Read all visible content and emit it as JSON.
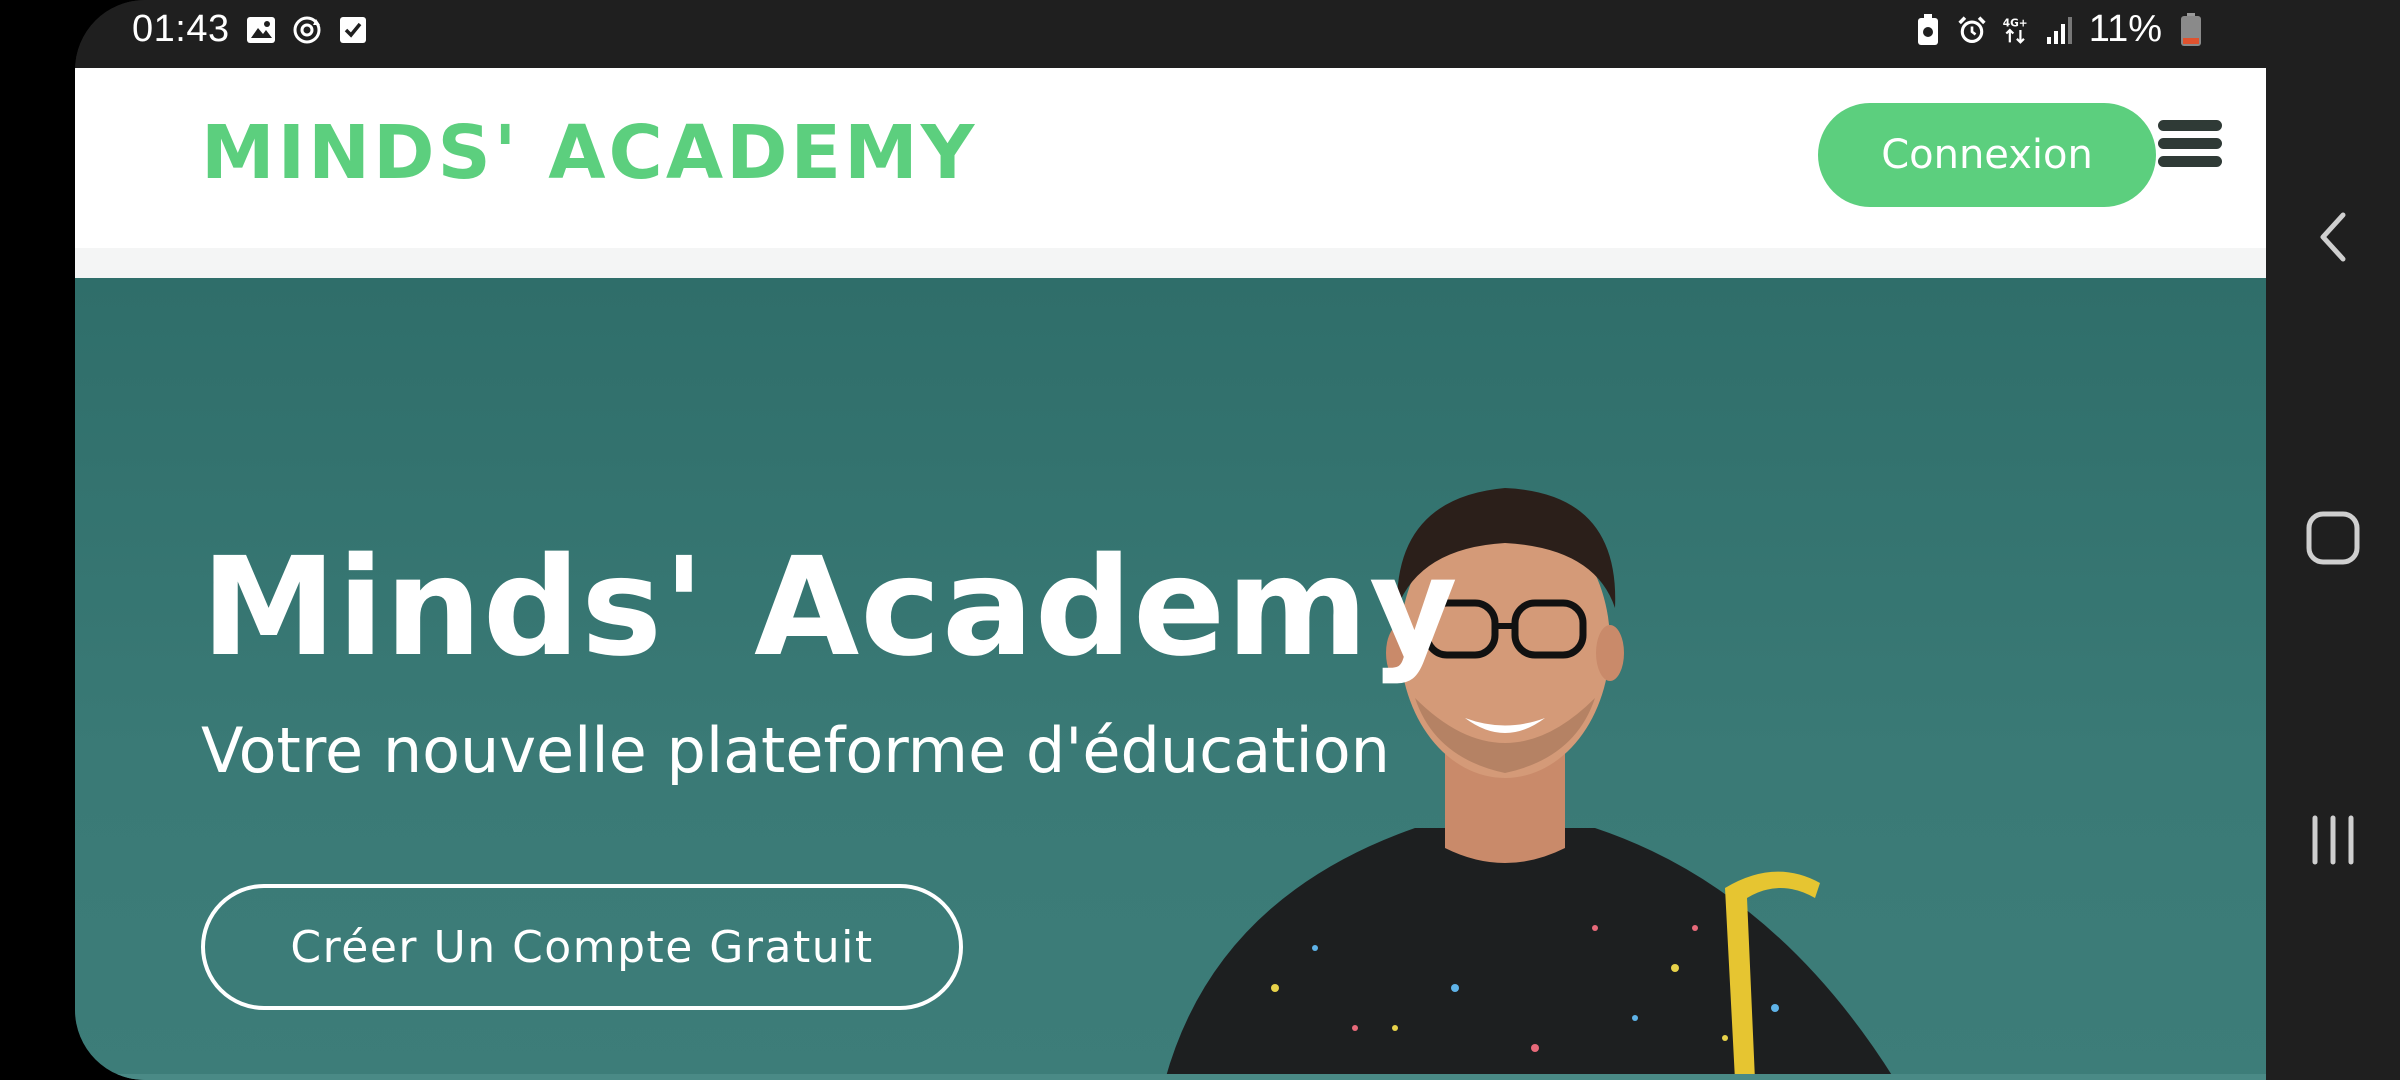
{
  "status_bar": {
    "time": "01:43",
    "battery": "11%",
    "left_icons": [
      "image-icon",
      "sync-icon",
      "checkbox-icon"
    ],
    "right_icons": [
      "battery-saver-icon",
      "alarm-icon",
      "network-4g-icon",
      "signal-icon",
      "battery-icon"
    ]
  },
  "header": {
    "brand": "MINDS' ACADEMY",
    "login_label": "Connexion",
    "menu_icon": "hamburger-icon"
  },
  "hero": {
    "title": "Minds' Academy",
    "subtitle": "Votre nouvelle plateforme d'éducation",
    "cta_label": "Créer Un Compte Gratuit"
  },
  "nav_bar": {
    "buttons": [
      "back-icon",
      "home-icon",
      "recents-icon"
    ]
  },
  "colors": {
    "brand_green": "#5ccf7e",
    "hero_teal": "#3a7a76",
    "system_bar": "#1f1f1f"
  }
}
